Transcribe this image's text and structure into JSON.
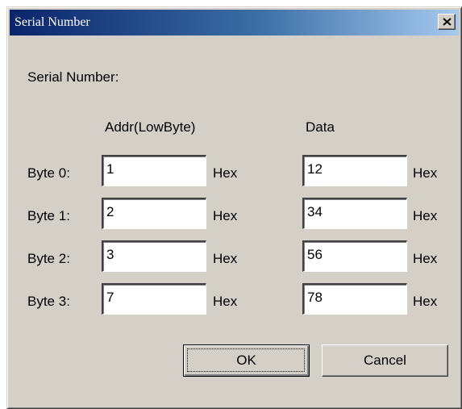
{
  "window": {
    "title": "Serial Number",
    "close_icon": "close-icon"
  },
  "heading": "Serial Number:",
  "columns": {
    "addr": "Addr(LowByte)",
    "data": "Data"
  },
  "rows": [
    {
      "label": "Byte 0:",
      "addr": "1",
      "data": "12"
    },
    {
      "label": "Byte 1:",
      "addr": "2",
      "data": "34"
    },
    {
      "label": "Byte 2:",
      "addr": "3",
      "data": "56"
    },
    {
      "label": "Byte 3:",
      "addr": "7",
      "data": "78"
    }
  ],
  "unit": "Hex",
  "buttons": {
    "ok": "OK",
    "cancel": "Cancel"
  },
  "colors": {
    "title_start": "#0a246a",
    "title_end": "#a6caf0",
    "face": "#d4d0c8"
  }
}
